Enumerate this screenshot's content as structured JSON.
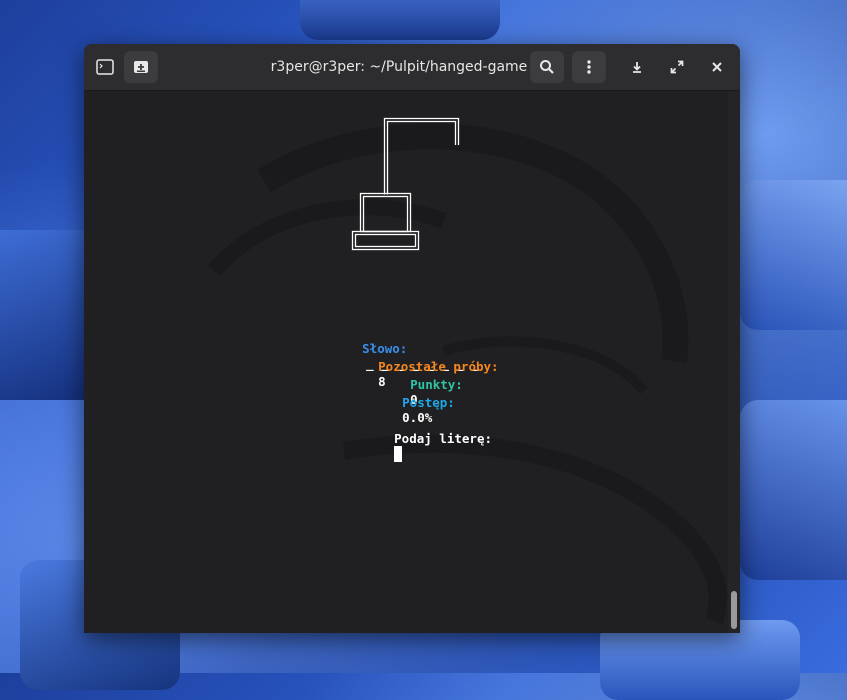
{
  "window": {
    "title": "r3per@r3per: ~/Pulpit/hanged-game"
  },
  "titlebar": {
    "icons": [
      "terminal-icon",
      "new-tab-icon",
      "search-icon",
      "menu-dots-icon",
      "download-icon",
      "fullscreen-icon",
      "close-icon"
    ]
  },
  "game": {
    "word_label": "Słowo:",
    "word_value": "_ _ _ _ _ _ _ _",
    "attempts_label": "Pozostałe próby:",
    "attempts_value": "8",
    "points_label": "Punkty:",
    "points_value": "0",
    "progress_label": "Postęp:",
    "progress_value": "0.0%",
    "prompt": "Podaj literę:"
  },
  "colors": {
    "word_label": "#3b8eea",
    "attempts_label": "#f5871f",
    "points_label": "#2ec4a4",
    "progress_label": "#1ea7e8",
    "terminal_bg": "#202022",
    "titlebar_bg": "#2d2d2f"
  }
}
